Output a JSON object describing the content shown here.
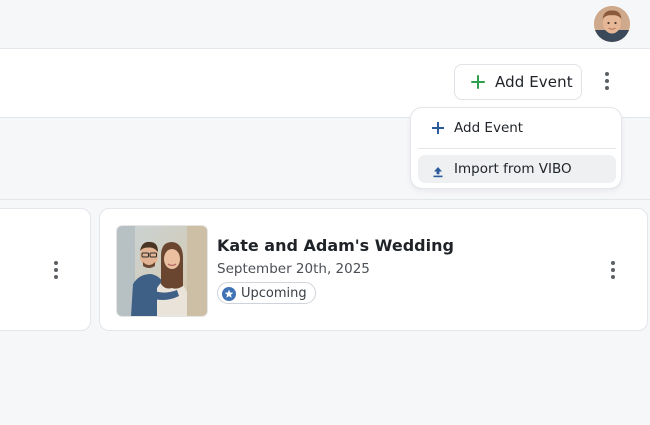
{
  "header": {
    "avatar_icon": "user-avatar-photo"
  },
  "toolbar": {
    "add_event_label": "Add Event",
    "add_event_icon": "plus-icon",
    "more_icon": "kebab-menu-icon",
    "accent_color": "#2e9e4f"
  },
  "menu": {
    "items": [
      {
        "label": "Add Event",
        "icon": "plus-icon"
      },
      {
        "label": "Import from VIBO",
        "icon": "upload-icon"
      }
    ],
    "icon_color": "#2b5b9a"
  },
  "events": [
    {
      "title": "Kate and Adam's Wedding",
      "date": "September 20th, 2025",
      "status": "Upcoming",
      "status_icon": "star-badge-icon",
      "status_color": "#3f73b5"
    }
  ]
}
